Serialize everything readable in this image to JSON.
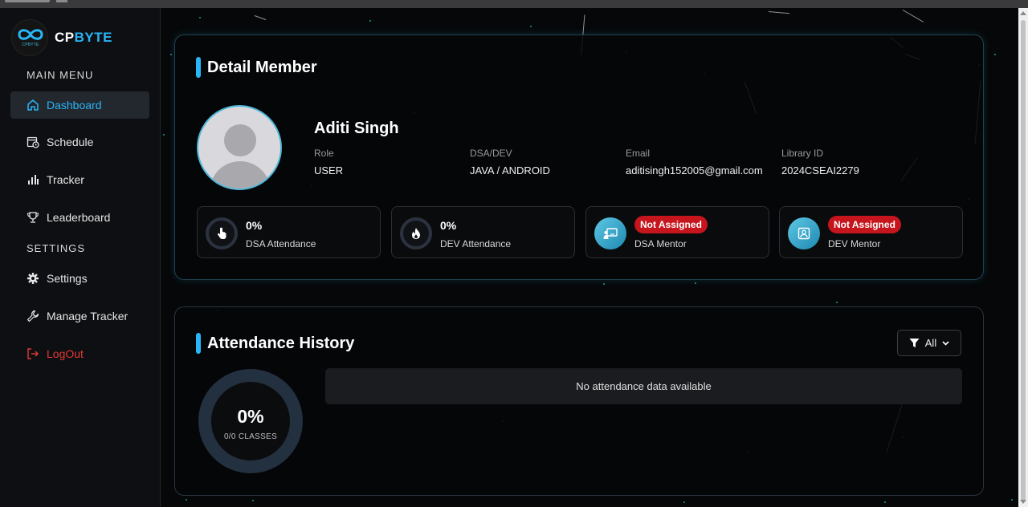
{
  "brand": {
    "logo_text": "CPBYTE",
    "name_cp": "CP",
    "name_byte": "BYTE"
  },
  "sidebar": {
    "main_menu_label": "MAIN MENU",
    "settings_label": "SETTINGS",
    "items": [
      {
        "label": "Dashboard",
        "icon": "home-icon",
        "active": true
      },
      {
        "label": "Schedule",
        "icon": "calendar-clock-icon"
      },
      {
        "label": "Tracker",
        "icon": "bar-chart-icon"
      },
      {
        "label": "Leaderboard",
        "icon": "trophy-icon"
      },
      {
        "label": "Settings",
        "icon": "gear-icon"
      },
      {
        "label": "Manage Tracker",
        "icon": "wrench-icon"
      },
      {
        "label": "LogOut",
        "icon": "logout-icon"
      }
    ]
  },
  "member": {
    "title": "Detail Member",
    "name": "Aditi Singh",
    "fields": [
      {
        "label": "Role",
        "value": "USER"
      },
      {
        "label": "DSA/DEV",
        "value": "JAVA / ANDROID"
      },
      {
        "label": "Email",
        "value": "aditisingh152005@gmail.com"
      },
      {
        "label": "Library ID",
        "value": "2024CSEAI2279"
      }
    ],
    "stats": [
      {
        "value": "0%",
        "label": "DSA Attendance",
        "icon": "hand-pointer-icon"
      },
      {
        "value": "0%",
        "label": "DEV Attendance",
        "icon": "fire-icon"
      },
      {
        "badge": "Not Assigned",
        "label": "DSA Mentor",
        "icon": "presentation-icon"
      },
      {
        "badge": "Not Assigned",
        "label": "DEV Mentor",
        "icon": "portrait-icon"
      }
    ]
  },
  "history": {
    "title": "Attendance History",
    "filter_label": "All",
    "percent": "0%",
    "classes": "0/0 CLASSES",
    "empty_message": "No attendance data available"
  },
  "colors": {
    "accent": "#29b6f6",
    "danger": "#e53935",
    "badge": "#c6151c"
  }
}
